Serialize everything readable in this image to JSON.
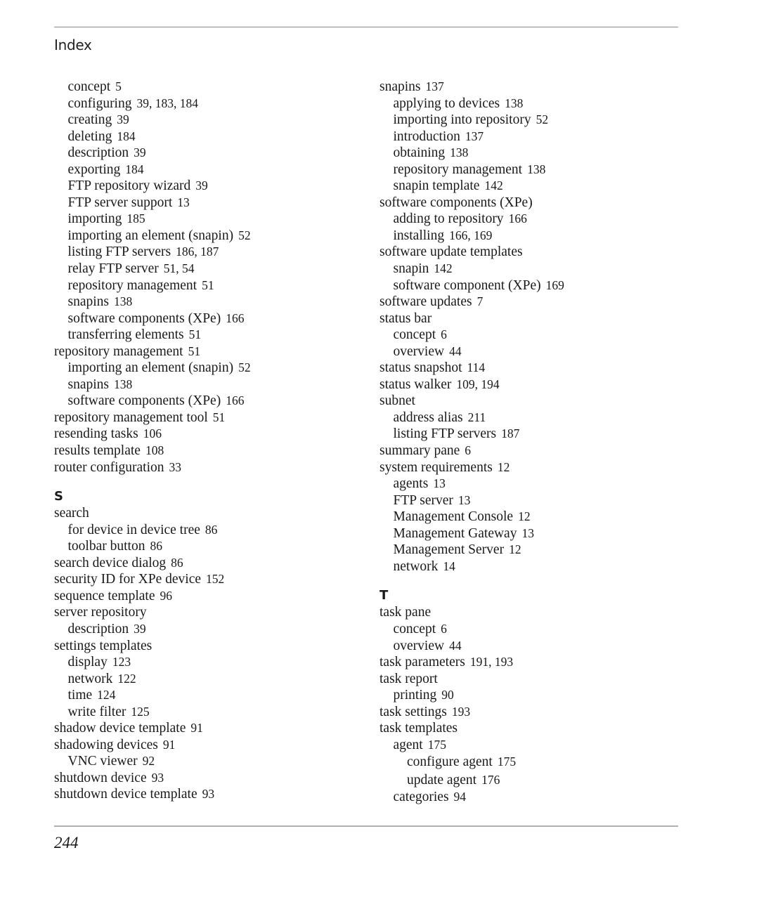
{
  "header": {
    "title": "Index"
  },
  "footer": {
    "page_number": "244"
  },
  "left_column": [
    {
      "level": 1,
      "term": "concept",
      "pages": "5"
    },
    {
      "level": 1,
      "term": "configuring",
      "pages": "39, 183, 184"
    },
    {
      "level": 1,
      "term": "creating",
      "pages": "39"
    },
    {
      "level": 1,
      "term": "deleting",
      "pages": "184"
    },
    {
      "level": 1,
      "term": "description",
      "pages": "39"
    },
    {
      "level": 1,
      "term": "exporting",
      "pages": "184"
    },
    {
      "level": 1,
      "term": "FTP repository wizard",
      "pages": "39"
    },
    {
      "level": 1,
      "term": "FTP server support",
      "pages": "13"
    },
    {
      "level": 1,
      "term": "importing",
      "pages": "185"
    },
    {
      "level": 1,
      "term": "importing an element (snapin)",
      "pages": "52"
    },
    {
      "level": 1,
      "term": "listing FTP servers",
      "pages": "186, 187"
    },
    {
      "level": 1,
      "term": "relay FTP server",
      "pages": "51, 54"
    },
    {
      "level": 1,
      "term": "repository management",
      "pages": "51"
    },
    {
      "level": 1,
      "term": "snapins",
      "pages": "138"
    },
    {
      "level": 1,
      "term": "software components (XPe)",
      "pages": "166"
    },
    {
      "level": 1,
      "term": "transferring elements",
      "pages": "51"
    },
    {
      "level": 0,
      "term": "repository management",
      "pages": "51"
    },
    {
      "level": 1,
      "term": "importing an element (snapin)",
      "pages": "52"
    },
    {
      "level": 1,
      "term": "snapins",
      "pages": "138"
    },
    {
      "level": 1,
      "term": "software components (XPe)",
      "pages": "166"
    },
    {
      "level": 0,
      "term": "repository management tool",
      "pages": "51"
    },
    {
      "level": 0,
      "term": "resending tasks",
      "pages": "106"
    },
    {
      "level": 0,
      "term": "results template",
      "pages": "108"
    },
    {
      "level": 0,
      "term": "router configuration",
      "pages": "33"
    },
    {
      "letter": "S"
    },
    {
      "level": 0,
      "term": "search",
      "pages": ""
    },
    {
      "level": 1,
      "term": "for device in device tree",
      "pages": "86"
    },
    {
      "level": 1,
      "term": "toolbar button",
      "pages": "86"
    },
    {
      "level": 0,
      "term": "search device dialog",
      "pages": "86"
    },
    {
      "level": 0,
      "term": "security ID for XPe device",
      "pages": "152"
    },
    {
      "level": 0,
      "term": "sequence template",
      "pages": "96"
    },
    {
      "level": 0,
      "term": "server repository",
      "pages": ""
    },
    {
      "level": 1,
      "term": "description",
      "pages": "39"
    },
    {
      "level": 0,
      "term": "settings templates",
      "pages": ""
    },
    {
      "level": 1,
      "term": "display",
      "pages": "123"
    },
    {
      "level": 1,
      "term": "network",
      "pages": "122"
    },
    {
      "level": 1,
      "term": "time",
      "pages": "124"
    },
    {
      "level": 1,
      "term": "write filter",
      "pages": "125"
    },
    {
      "level": 0,
      "term": "shadow device template",
      "pages": "91"
    },
    {
      "level": 0,
      "term": "shadowing devices",
      "pages": "91"
    },
    {
      "level": 1,
      "term": "VNC viewer",
      "pages": "92"
    },
    {
      "level": 0,
      "term": "shutdown device",
      "pages": "93"
    },
    {
      "level": 0,
      "term": "shutdown device template",
      "pages": "93"
    }
  ],
  "right_column": [
    {
      "level": 0,
      "term": "snapins",
      "pages": "137"
    },
    {
      "level": 1,
      "term": "applying to devices",
      "pages": "138"
    },
    {
      "level": 1,
      "term": "importing into repository",
      "pages": "52"
    },
    {
      "level": 1,
      "term": "introduction",
      "pages": "137"
    },
    {
      "level": 1,
      "term": "obtaining",
      "pages": "138"
    },
    {
      "level": 1,
      "term": "repository management",
      "pages": "138"
    },
    {
      "level": 1,
      "term": "snapin template",
      "pages": "142"
    },
    {
      "level": 0,
      "term": "software components (XPe)",
      "pages": ""
    },
    {
      "level": 1,
      "term": "adding to repository",
      "pages": "166"
    },
    {
      "level": 1,
      "term": "installing",
      "pages": "166, 169"
    },
    {
      "level": 0,
      "term": "software update templates",
      "pages": ""
    },
    {
      "level": 1,
      "term": "snapin",
      "pages": "142"
    },
    {
      "level": 1,
      "term": "software component (XPe)",
      "pages": "169"
    },
    {
      "level": 0,
      "term": "software updates",
      "pages": "7"
    },
    {
      "level": 0,
      "term": "status bar",
      "pages": ""
    },
    {
      "level": 1,
      "term": "concept",
      "pages": "6"
    },
    {
      "level": 1,
      "term": "overview",
      "pages": "44"
    },
    {
      "level": 0,
      "term": "status snapshot",
      "pages": "114"
    },
    {
      "level": 0,
      "term": "status walker",
      "pages": "109, 194"
    },
    {
      "level": 0,
      "term": "subnet",
      "pages": ""
    },
    {
      "level": 1,
      "term": "address alias",
      "pages": "211"
    },
    {
      "level": 1,
      "term": "listing FTP servers",
      "pages": "187"
    },
    {
      "level": 0,
      "term": "summary pane",
      "pages": "6"
    },
    {
      "level": 0,
      "term": "system requirements",
      "pages": "12"
    },
    {
      "level": 1,
      "term": "agents",
      "pages": "13"
    },
    {
      "level": 1,
      "term": "FTP server",
      "pages": "13"
    },
    {
      "level": 1,
      "term": "Management Console",
      "pages": "12"
    },
    {
      "level": 1,
      "term": "Management Gateway",
      "pages": "13"
    },
    {
      "level": 1,
      "term": "Management Server",
      "pages": "12"
    },
    {
      "level": 1,
      "term": "network",
      "pages": "14"
    },
    {
      "letter": "T"
    },
    {
      "level": 0,
      "term": "task pane",
      "pages": ""
    },
    {
      "level": 1,
      "term": "concept",
      "pages": "6"
    },
    {
      "level": 1,
      "term": "overview",
      "pages": "44"
    },
    {
      "level": 0,
      "term": "task parameters",
      "pages": "191, 193"
    },
    {
      "level": 0,
      "term": "task report",
      "pages": ""
    },
    {
      "level": 1,
      "term": "printing",
      "pages": "90"
    },
    {
      "level": 0,
      "term": "task settings",
      "pages": "193"
    },
    {
      "level": 0,
      "term": "task templates",
      "pages": ""
    },
    {
      "level": 1,
      "term": "agent",
      "pages": "175"
    },
    {
      "level": 2,
      "term": "configure agent",
      "pages": "175"
    },
    {
      "level": 2,
      "term": "update agent",
      "pages": "176"
    },
    {
      "level": 1,
      "term": "categories",
      "pages": "94"
    }
  ]
}
